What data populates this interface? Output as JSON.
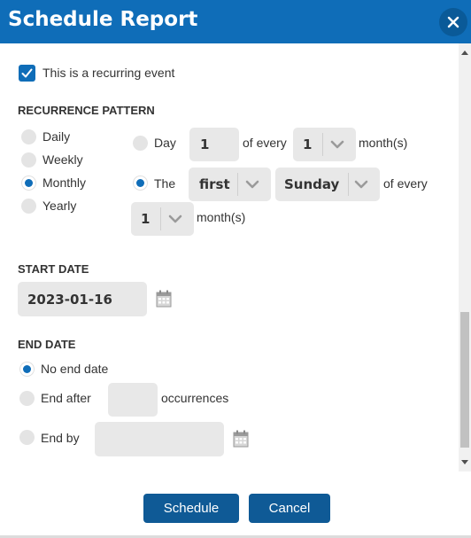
{
  "dialog": {
    "title": "Schedule Report",
    "close_icon": "close-icon"
  },
  "recurring": {
    "checked": true,
    "label": "This is a recurring event"
  },
  "recurrence_pattern": {
    "heading": "RECURRENCE PATTERN",
    "options": [
      {
        "label": "Daily",
        "selected": false
      },
      {
        "label": "Weekly",
        "selected": false
      },
      {
        "label": "Monthly",
        "selected": true
      },
      {
        "label": "Yearly",
        "selected": false
      }
    ],
    "monthly": {
      "day_option": {
        "label": "Day",
        "selected": false,
        "day_value": "1",
        "of_every_label": "of every",
        "months_value": "1",
        "months_label": "month(s)"
      },
      "the_option": {
        "label": "The",
        "selected": true,
        "ordinal_value": "first",
        "weekday_value": "Sunday",
        "of_every_label": "of every",
        "months_value": "1",
        "months_label": "month(s)"
      }
    }
  },
  "start_date": {
    "heading": "START DATE",
    "value": "2023-01-16"
  },
  "end_date": {
    "heading": "END DATE",
    "options": [
      {
        "label": "No end date",
        "selected": true
      },
      {
        "label": "End after",
        "selected": false,
        "value": "",
        "suffix": "occurrences"
      },
      {
        "label": "End by",
        "selected": false,
        "value": ""
      }
    ]
  },
  "buttons": {
    "schedule_label": "Schedule",
    "cancel_label": "Cancel"
  },
  "colors": {
    "accent": "#0f6db8",
    "button": "#0f5a96",
    "field_bg": "#e8e8e8"
  }
}
